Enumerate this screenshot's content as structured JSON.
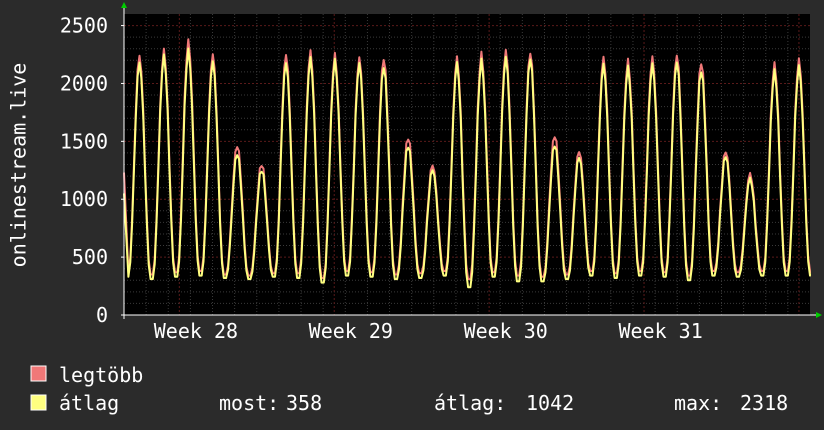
{
  "chart_data": {
    "type": "line",
    "ylabel": "onlinestream.live",
    "ylim": [
      0,
      2600
    ],
    "yticks": [
      0,
      500,
      1000,
      1500,
      2000,
      2500
    ],
    "xlim": [
      0,
      31
    ],
    "xticks": [
      {
        "label": "Week 28",
        "x": 3.25
      },
      {
        "label": "Week 29",
        "x": 10.25
      },
      {
        "label": "Week 30",
        "x": 17.25
      },
      {
        "label": "Week 31",
        "x": 24.25
      }
    ],
    "grid": true,
    "colors": {
      "background": "#2b2b2b",
      "plot_area": "#000000",
      "grid_major": "#5a1a1a",
      "grid_minor": "#3a3a3a",
      "max_series": "#f07878",
      "avg_series": "#ffff80",
      "axis_arrow": "#00cc00"
    },
    "series": [
      {
        "name": "legtöbb",
        "color": "#f07878",
        "daily_peaks": [
          2240,
          2280,
          2360,
          2250,
          1470,
          1310,
          2250,
          2270,
          2240,
          2220,
          2220,
          1540,
          1300,
          2220,
          2250,
          2280,
          2270,
          1560,
          1420,
          2220,
          2190,
          2220,
          2250,
          2190,
          1420,
          1220,
          2160,
          2200
        ],
        "daily_troughs": [
          370,
          350,
          370,
          380,
          350,
          340,
          360,
          360,
          320,
          380,
          370,
          350,
          360,
          380,
          310,
          370,
          340,
          330,
          350,
          380,
          360,
          380,
          370,
          340,
          380,
          370,
          380,
          380
        ],
        "start": 1230,
        "end": 360
      },
      {
        "name": "átlag",
        "color": "#ffff80",
        "daily_peaks": [
          2180,
          2230,
          2280,
          2190,
          1400,
          1260,
          2180,
          2210,
          2190,
          2170,
          2150,
          1470,
          1260,
          2170,
          2190,
          2220,
          2220,
          1480,
          1370,
          2160,
          2130,
          2160,
          2190,
          2120,
          1380,
          1180,
          2100,
          2140
        ],
        "daily_troughs": [
          330,
          310,
          330,
          340,
          320,
          310,
          330,
          320,
          280,
          340,
          330,
          310,
          320,
          340,
          240,
          330,
          290,
          290,
          310,
          340,
          320,
          340,
          330,
          300,
          340,
          330,
          340,
          340
        ],
        "start": 1050,
        "end": 358
      }
    ],
    "legend": {
      "placement": "bottom-left",
      "items": [
        {
          "label": "legtöbb",
          "color": "#f07878"
        },
        {
          "label": "átlag",
          "color": "#ffff80"
        }
      ]
    },
    "stats": {
      "now_label": "most:",
      "now_value": "358",
      "avg_label": "átlag:",
      "avg_value": "1042",
      "max_label": "max:",
      "max_value": "2318"
    }
  }
}
